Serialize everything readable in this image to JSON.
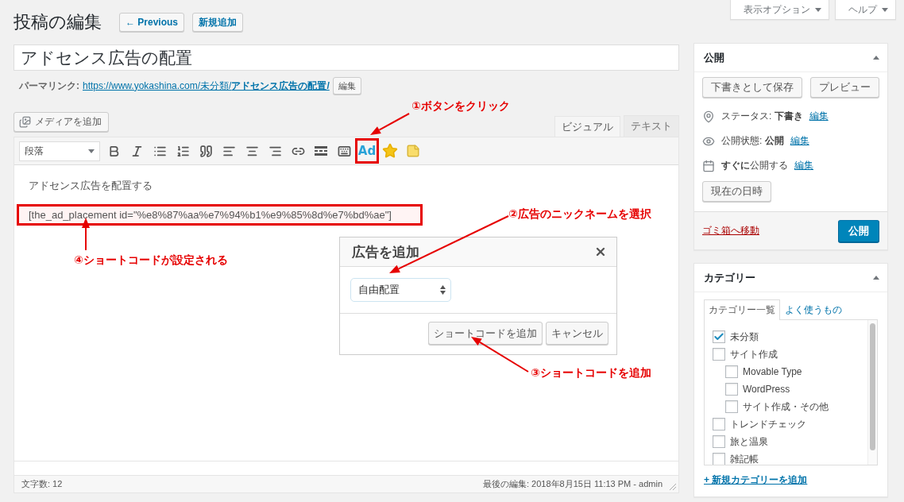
{
  "screen_tabs": [
    {
      "label": "表示オプション"
    },
    {
      "label": "ヘルプ"
    }
  ],
  "header": {
    "title": "投稿の編集",
    "buttons": [
      "← Previous",
      "新規追加"
    ]
  },
  "post_title": "アドセンス広告の配置",
  "permalink": {
    "label": "パーマリンク:",
    "url": "https://www.yokashina.com/未分類/**アドセンス広告の配置/**",
    "button": "編集"
  },
  "media_button": "メディアを追加",
  "editor_tabs": [
    {
      "label": "ビジュアル",
      "selected": true
    },
    {
      "label": "テキスト",
      "selected": false
    }
  ],
  "toolbar": {
    "format": "段落",
    "tools": [
      {
        "kind": "bold",
        "highlighted": false
      },
      {
        "kind": "italic",
        "highlighted": false
      },
      {
        "kind": "bullet-list",
        "highlighted": false
      },
      {
        "kind": "numbered-list",
        "highlighted": false
      },
      {
        "kind": "quote",
        "highlighted": false
      },
      {
        "kind": "align-left",
        "highlighted": false
      },
      {
        "kind": "align-center",
        "highlighted": false
      },
      {
        "kind": "align-right",
        "highlighted": false
      },
      {
        "kind": "link",
        "highlighted": false
      },
      {
        "kind": "more",
        "highlighted": false
      },
      {
        "kind": "keyboard",
        "highlighted": false
      },
      {
        "kind": "ad",
        "label": "Ad",
        "highlighted": true
      },
      {
        "kind": "star",
        "highlighted": false
      },
      {
        "kind": "note",
        "highlighted": false
      }
    ]
  },
  "content": [
    {
      "text": "アドセンス広告を配置する",
      "highlighted": false
    },
    {
      "text": "[the_ad_placement id=\"%e8%87%aa%e7%94%b1%e9%85%8d%e7%bd%ae\"]",
      "highlighted": true
    }
  ],
  "dialog": {
    "title": "広告を追加",
    "select": "自由配置",
    "buttons": [
      "ショートコードを追加",
      "キャンセル"
    ]
  },
  "annotations": [
    {
      "text": "①ボタンをクリック"
    },
    {
      "text": "②広告のニックネームを選択"
    },
    {
      "text": "③ショートコードを追加"
    },
    {
      "text": "④ショートコードが設定される"
    }
  ],
  "status_bar": {
    "word_count": "文字数: 12",
    "last_edit": "最後の編集: 2018年8月15日 11:13 PM - admin"
  },
  "publish_box": {
    "title": "公開",
    "buttons": [
      "下書きとして保存",
      "プレビュー"
    ],
    "rows": [
      {
        "kind": "status",
        "text": "ステータス: **下書き**",
        "link": "編集"
      },
      {
        "kind": "visibility",
        "text": "公開状態: **公開**",
        "link": "編集"
      },
      {
        "kind": "schedule",
        "text": "**すぐに**公開する",
        "link": "編集"
      }
    ],
    "date_button": "現在の日時",
    "trash": "ゴミ箱へ移動",
    "publish": "公開"
  },
  "category_box": {
    "title": "カテゴリー",
    "tabs": [
      {
        "label": "カテゴリー一覧",
        "selected": true
      },
      {
        "label": "よく使うもの",
        "selected": false
      }
    ],
    "items": [
      {
        "label": "未分類",
        "checked": true
      },
      {
        "label": "サイト作成",
        "checked": false,
        "children": [
          {
            "label": "Movable Type",
            "checked": false
          },
          {
            "label": "WordPress",
            "checked": false
          },
          {
            "label": "サイト作成・その他",
            "checked": false
          }
        ]
      },
      {
        "label": "トレンドチェック",
        "checked": false
      },
      {
        "label": "旅と温泉",
        "checked": false
      },
      {
        "label": "雑記帳",
        "checked": false
      }
    ],
    "add_link": "+ 新規カテゴリーを追加"
  }
}
